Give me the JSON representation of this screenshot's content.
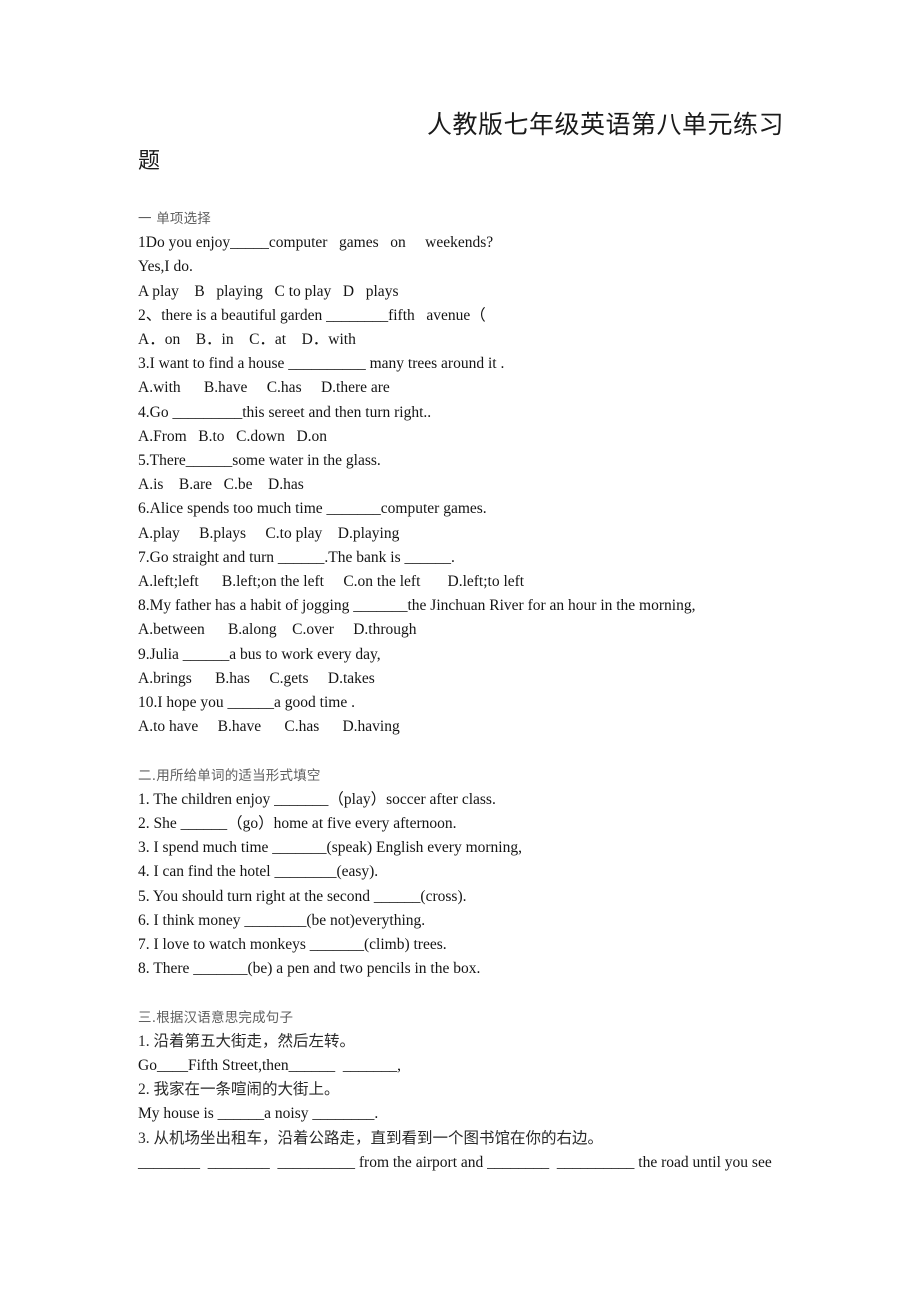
{
  "document": {
    "title_line1": "人教版七年级英语第八单元练习",
    "title_line2": "题"
  },
  "sections": [
    {
      "id": "section-one",
      "heading": "一 单项选择",
      "lines": [
        "1Do you enjoy_____computer   games   on     weekends?",
        "Yes,I do.",
        "A play    B   playing   C to play   D   plays",
        "2、there is a beautiful garden ________fifth   avenue（",
        "A．on    B．in    C．at    D．with",
        "3.I want to find a house __________ many trees around it .",
        "A.with      B.have     C.has     D.there are",
        "4.Go _________this sereet and then turn right..",
        "A.From   B.to   C.down   D.on",
        "5.There______some water in the glass.",
        "A.is    B.are   C.be    D.has",
        "6.Alice spends too much time _______computer games.",
        "A.play     B.plays     C.to play    D.playing",
        "7.Go straight and turn ______.The bank is ______.",
        "A.left;left      B.left;on the left     C.on the left       D.left;to left",
        "8.My father has a habit of jogging _______the Jinchuan River for an hour in the morning,",
        "A.between      B.along    C.over     D.through",
        "9.Julia ______a bus to work every day,",
        "A.brings      B.has     C.gets     D.takes",
        "10.I hope you ______a good time .",
        "A.to have     B.have      C.has      D.having"
      ]
    },
    {
      "id": "section-two",
      "heading": "二.用所给单词的适当形式填空",
      "lines": [
        "1. The children enjoy _______（play）soccer after class.",
        "2. She ______（go）home at five every afternoon.",
        "3. I spend much time _______(speak) English every morning,",
        "4. I can find the hotel ________(easy).",
        "5. You should turn right at the second ______(cross).",
        "6. I think money ________(be not)everything.",
        "7. I love to watch monkeys _______(climb) trees.",
        "8. There _______(be) a pen and two pencils in the box."
      ]
    },
    {
      "id": "section-three",
      "heading": "三.根据汉语意思完成句子",
      "lines": [
        "1. 沿着第五大街走，然后左转。",
        "Go____Fifth Street,then______  _______,",
        "2. 我家在一条喧闹的大街上。",
        "My house is ______a noisy ________.",
        "3. 从机场坐出租车，沿着公路走，直到看到一个图书馆在你的右边。",
        "________  ________  __________ from the airport and ________  __________ the road until you see"
      ]
    }
  ]
}
